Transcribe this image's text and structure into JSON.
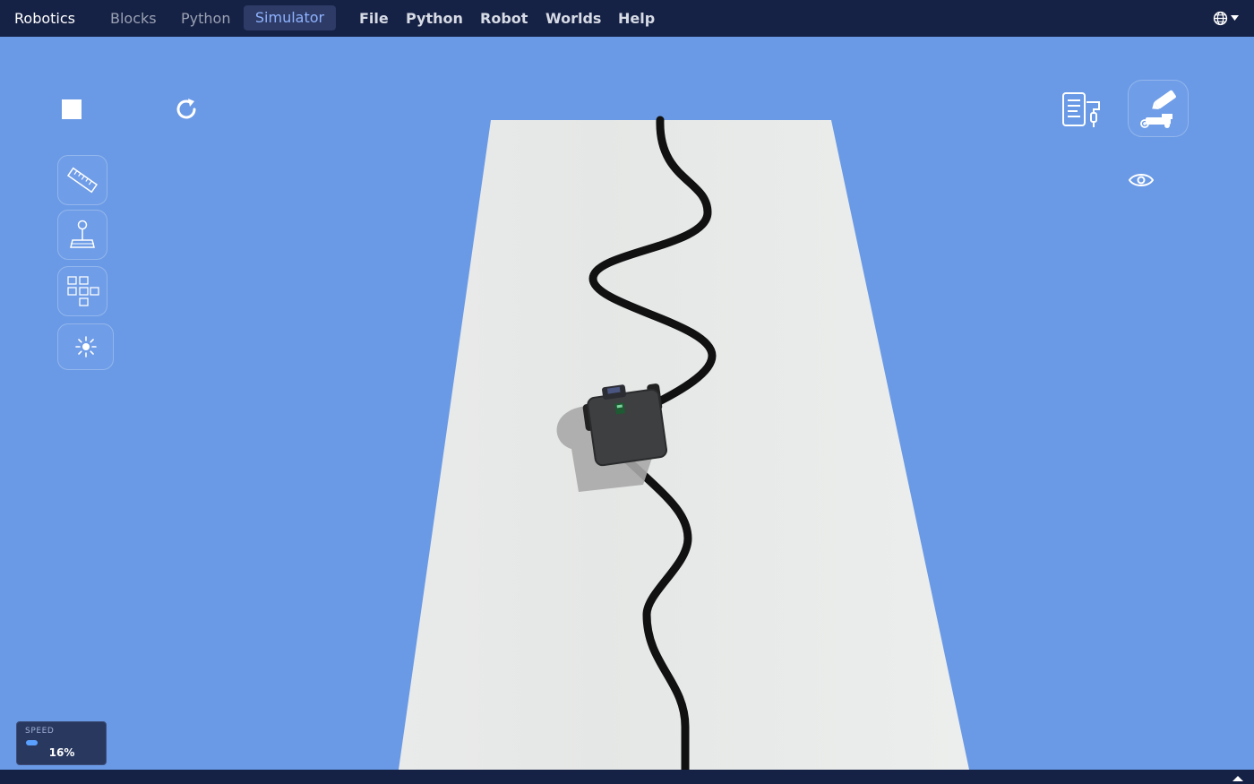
{
  "app": {
    "title": "Robotics"
  },
  "nav": {
    "tabs": [
      {
        "label": "Blocks",
        "active": false
      },
      {
        "label": "Python",
        "active": false
      },
      {
        "label": "Simulator",
        "active": true
      }
    ],
    "menu": [
      "File",
      "Python",
      "Robot",
      "Worlds",
      "Help"
    ],
    "language_icon": "globe-icon"
  },
  "toolbar": {
    "left": [
      "stop-icon",
      "reset-icon"
    ],
    "side": [
      "ruler-icon",
      "joystick-icon",
      "blocks-icon",
      "light-icon"
    ],
    "right": [
      "program-icon",
      "robot-pen-icon",
      "eye-icon"
    ]
  },
  "speed": {
    "label": "SPEED",
    "value_text": "16%",
    "value": 0.16
  },
  "colors": {
    "topbar": "#162245",
    "sky": "#6a9ae6",
    "mat": "#eaecec",
    "line": "#111111",
    "accent": "#8fb2ff"
  }
}
